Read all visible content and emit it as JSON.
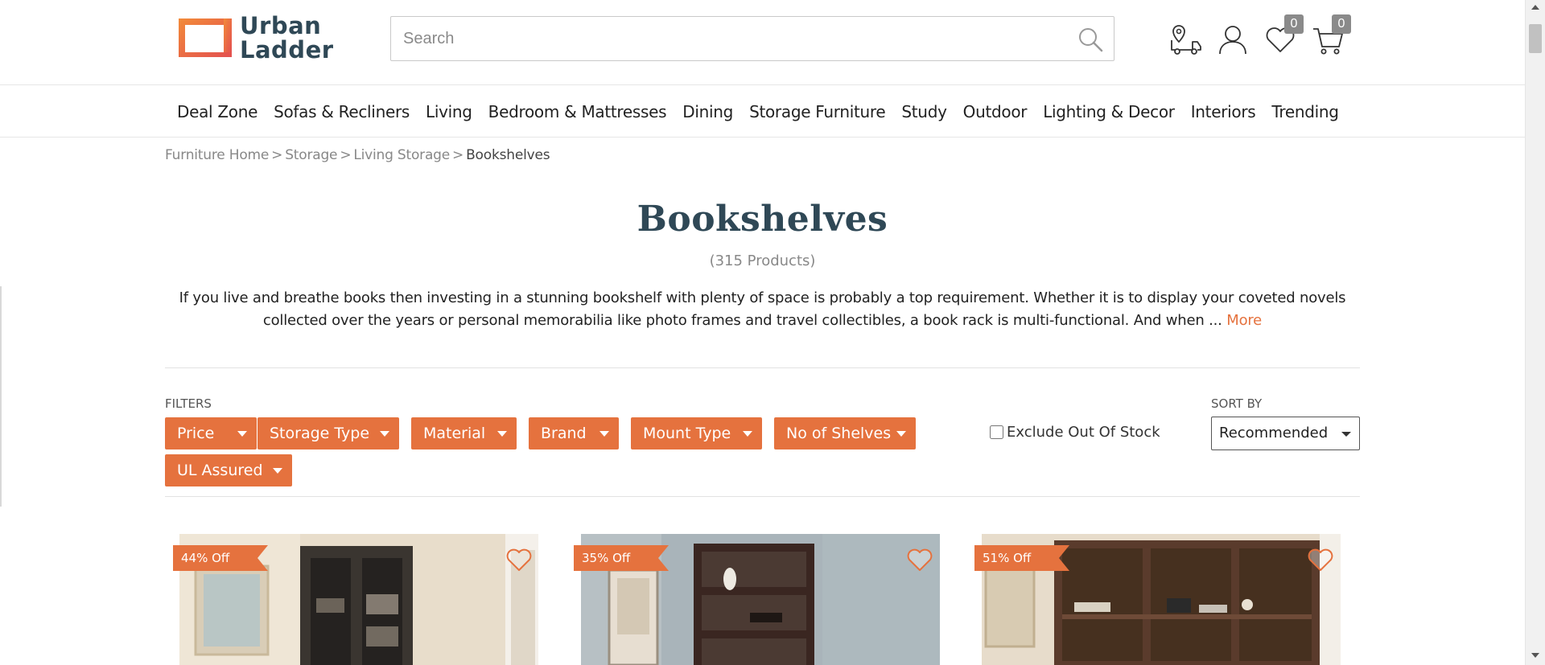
{
  "header": {
    "logo_line1": "Urban",
    "logo_line2": "Ladder",
    "logo_color": "#e5723e",
    "search_placeholder": "Search",
    "wishlist_count": "0",
    "cart_count": "0",
    "icons": [
      "track-order-icon",
      "account-icon",
      "wishlist-heart-icon",
      "cart-icon",
      "search-icon"
    ]
  },
  "nav": {
    "items": [
      "Deal Zone",
      "Sofas & Recliners",
      "Living",
      "Bedroom & Mattresses",
      "Dining",
      "Storage Furniture",
      "Study",
      "Outdoor",
      "Lighting & Decor",
      "Interiors",
      "Trending"
    ]
  },
  "breadcrumb": {
    "items": [
      "Furniture Home",
      "Storage",
      "Living Storage"
    ],
    "separator": ">",
    "current": "Bookshelves"
  },
  "page": {
    "title": "Bookshelves",
    "count": "(315 Products)",
    "description": "If you live and breathe books then investing in a stunning bookshelf with plenty of space is probably a top requirement. Whether it is to display your coveted novels collected over the years or personal memorabilia like photo frames and travel collectibles, a book rack is multi-functional. And when ...",
    "more_label": "More"
  },
  "filters": {
    "label": "FILTERS",
    "buttons": [
      "Price",
      "Storage Type",
      "Material",
      "Brand",
      "Mount Type",
      "No of Shelves",
      "UL Assured"
    ],
    "exclude_out_of_stock": "Exclude Out Of Stock",
    "exclude_checked": false
  },
  "sort": {
    "label": "SORT BY",
    "selected": "Recommended"
  },
  "products": [
    {
      "discount": "44% Off"
    },
    {
      "discount": "35% Off"
    },
    {
      "discount": "51% Off"
    }
  ],
  "colors": {
    "accent": "#e5723e",
    "title": "#2f4856",
    "muted": "#888888"
  }
}
